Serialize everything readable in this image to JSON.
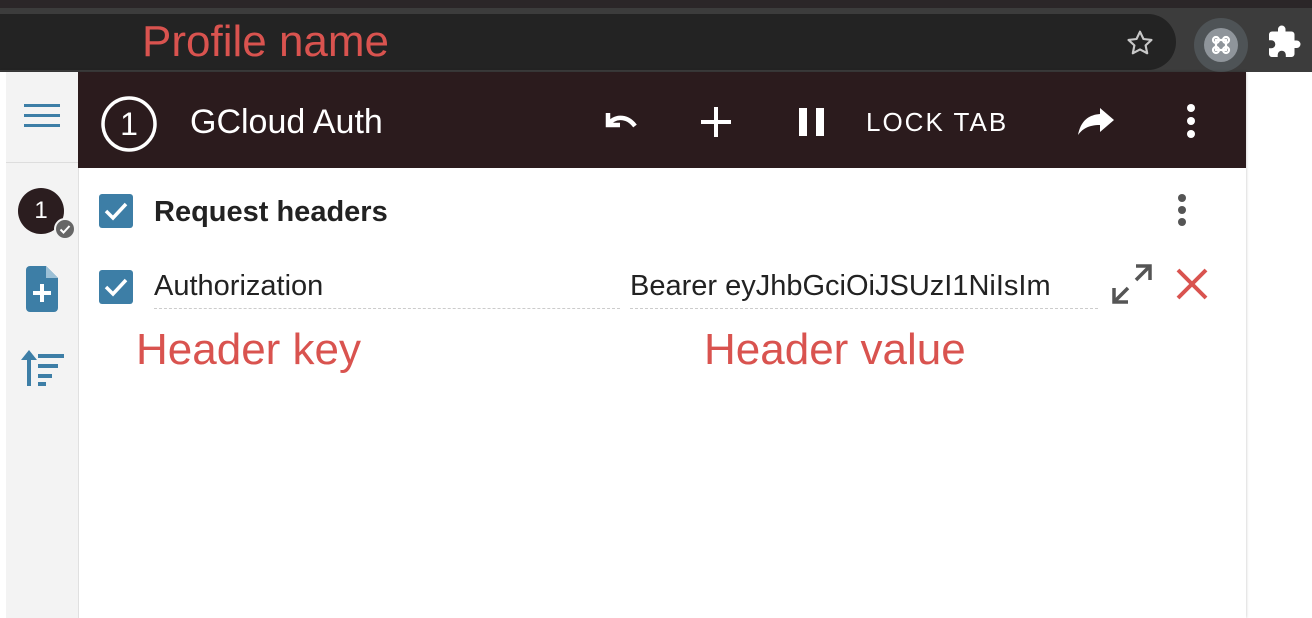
{
  "annotations": {
    "profile_name": "Profile name",
    "header_key": "Header key",
    "header_value": "Header value"
  },
  "browser": {
    "star_icon": "star-icon",
    "extension_icon": "modheader-icon",
    "extensions_icon": "puzzle-icon"
  },
  "sidebar": {
    "menu_icon": "hamburger-icon",
    "profile_badge": "1",
    "add_profile_icon": "add-file-icon",
    "sort_icon": "sort-icon"
  },
  "appbar": {
    "profile_number": "1",
    "profile_title": "GCloud Auth",
    "lock_tab_label": "LOCK TAB",
    "icons": [
      "undo-icon",
      "plus-icon",
      "pause-icon",
      "share-icon",
      "more-vert-icon"
    ]
  },
  "section": {
    "title": "Request headers",
    "enabled": true
  },
  "headers": [
    {
      "enabled": true,
      "key": "Authorization",
      "value": "Bearer eyJhbGciOiJSUzI1NiIsIm"
    }
  ],
  "colors": {
    "appbar_bg": "#2b1b1d",
    "checkbox": "#3d7ea6",
    "annotation": "#d9534f",
    "delete": "#d9534f",
    "sidebar_icon": "#3d7ea6"
  }
}
